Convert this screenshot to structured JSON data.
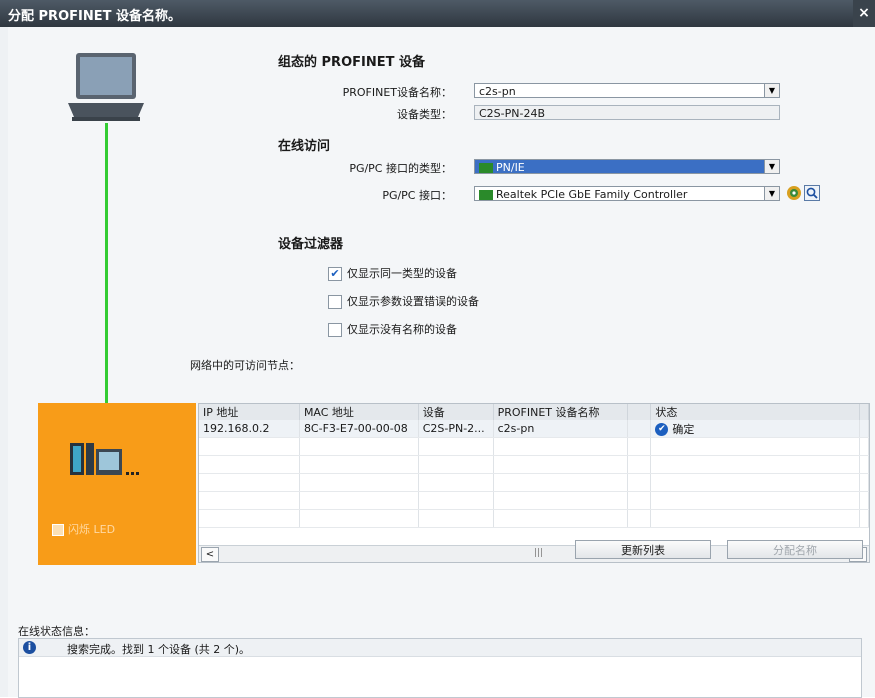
{
  "window": {
    "title": "分配 PROFINET 设备名称。",
    "close": "×"
  },
  "config": {
    "heading": "组态的 PROFINET 设备",
    "name_label": "PROFINET设备名称：",
    "name_value": "c2s-pn",
    "type_label": "设备类型：",
    "type_value": "C2S-PN-24B"
  },
  "online": {
    "heading": "在线访问",
    "iface_type_label": "PG/PC 接口的类型：",
    "iface_type_value": "PN/IE",
    "iface_label": "PG/PC 接口：",
    "iface_value": "Realtek PCIe GbE Family Controller"
  },
  "filter": {
    "heading": "设备过滤器",
    "options": [
      {
        "label": "仅显示同一类型的设备",
        "checked": true
      },
      {
        "label": "仅显示参数设置错误的设备",
        "checked": false
      },
      {
        "label": "仅显示没有名称的设备",
        "checked": false
      }
    ]
  },
  "led": {
    "label": "闪烁 LED"
  },
  "nodes": {
    "heading": "网络中的可访问节点：",
    "columns": [
      "IP 地址",
      "MAC 地址",
      "设备",
      "PROFINET 设备名称",
      "状态"
    ],
    "rows": [
      {
        "ip": "192.168.0.2",
        "mac": "8C-F3-E7-00-00-08",
        "device": "C2S-PN-2...",
        "name": "c2s-pn",
        "status": "确定"
      }
    ]
  },
  "buttons": {
    "refresh": "更新列表",
    "assign": "分配名称"
  },
  "status": {
    "heading": "在线状态信息：",
    "message": "搜索完成。找到 1 个设备 (共 2 个)。"
  },
  "colors": {
    "accent": "#3b6fc4",
    "orange": "#f89c18",
    "link_line": "#33cc33"
  }
}
